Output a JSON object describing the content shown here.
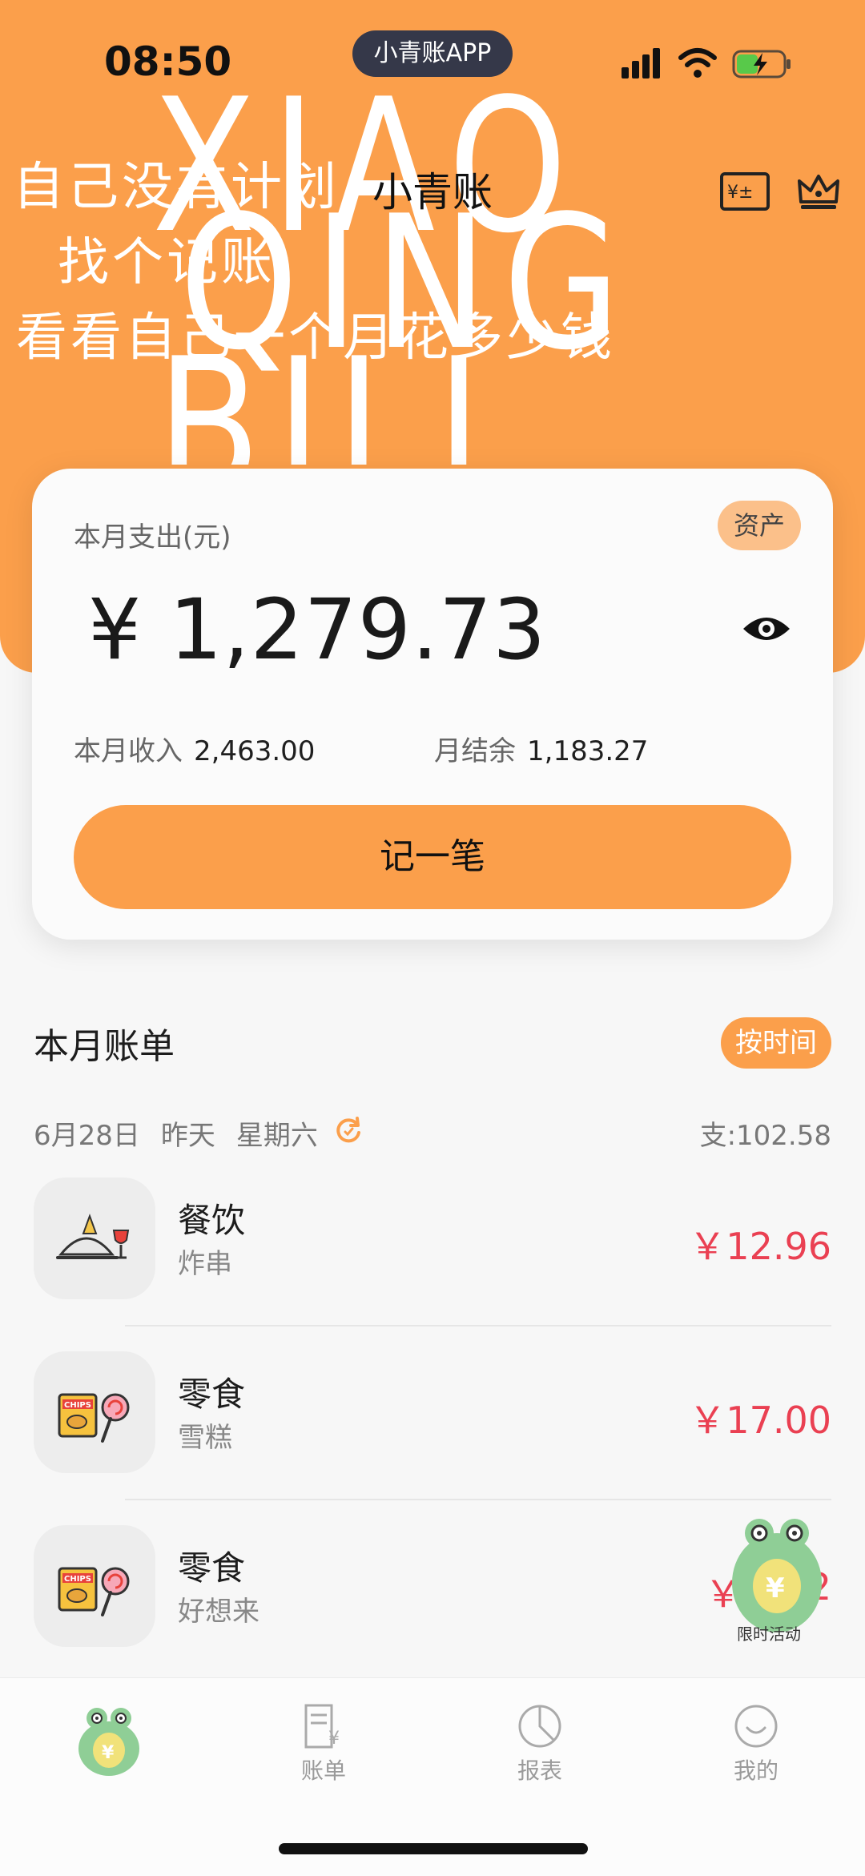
{
  "status_bar": {
    "time": "08:50",
    "app_name": "小青账APP"
  },
  "watermark": {
    "big_text": [
      "XIAO",
      "QING",
      "BILL"
    ],
    "lines": [
      "自己没有计划",
      "找个记账",
      "看看自己一个月花多少钱"
    ]
  },
  "nav": {
    "title": "小青账",
    "icons": [
      "ledger-exchange-icon",
      "crown-icon"
    ]
  },
  "summary": {
    "expense_label": "本月支出(元)",
    "assets_label": "资产",
    "expense_amount": "¥ 1,279.73",
    "income_label": "本月收入",
    "income_value": "2,463.00",
    "balance_label": "月结余",
    "balance_value": "1,183.27",
    "record_button": "记一笔"
  },
  "bills": {
    "title": "本月账单",
    "sort_label": "按时间",
    "date_group": {
      "date": "6月28日",
      "relative": "昨天",
      "weekday": "星期六",
      "total": "支:102.58"
    },
    "items": [
      {
        "category": "餐饮",
        "note": "炸串",
        "amount": "￥12.96",
        "icon": "dining-icon"
      },
      {
        "category": "零食",
        "note": "雪糕",
        "amount": "￥17.00",
        "icon": "snacks-icon"
      },
      {
        "category": "零食",
        "note": "好想来",
        "amount": "￥",
        "amount_tail": "2",
        "icon": "snacks-icon"
      }
    ]
  },
  "promo": {
    "label": "限时活动"
  },
  "tabs": [
    {
      "label": "",
      "icon": "frog-mascot-icon"
    },
    {
      "label": "账单",
      "icon": "bill-icon"
    },
    {
      "label": "报表",
      "icon": "pie-chart-icon"
    },
    {
      "label": "我的",
      "icon": "smile-icon"
    }
  ],
  "colors": {
    "brand": "#fb9f4b",
    "expense_red": "#ea4052",
    "pill_dark": "#353849"
  }
}
